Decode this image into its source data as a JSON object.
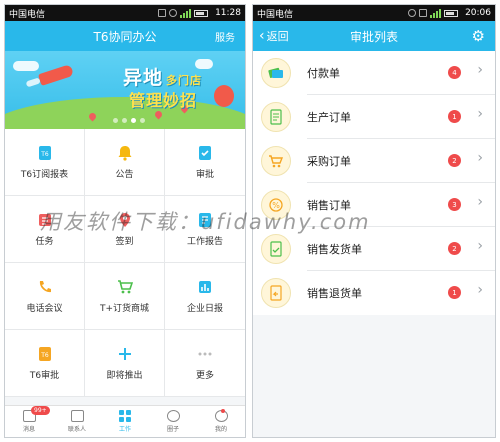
{
  "left": {
    "status": {
      "carrier": "中国电信",
      "time": "11:28"
    },
    "title": "T6协同办公",
    "right_action": "服务",
    "banner": {
      "headline": "异地",
      "headline_small": "多门店",
      "subline": "管理妙招",
      "tag": ""
    },
    "grid": [
      {
        "label": "T6订阅报表",
        "icon": "report-icon",
        "color": "#29b8ea"
      },
      {
        "label": "公告",
        "icon": "bell-icon",
        "color": "#f5b80f"
      },
      {
        "label": "审批",
        "icon": "approve-icon",
        "color": "#29b8ea"
      },
      {
        "label": "任务",
        "icon": "task-icon",
        "color": "#ef5e5e"
      },
      {
        "label": "签到",
        "icon": "checkin-icon",
        "color": "#ef5e5e"
      },
      {
        "label": "工作报告",
        "icon": "work-report-icon",
        "color": "#29b8ea"
      },
      {
        "label": "电话会议",
        "icon": "phone-icon",
        "color": "#f5a623"
      },
      {
        "label": "T+订货商城",
        "icon": "cart-icon",
        "color": "#4cbf4c"
      },
      {
        "label": "企业日报",
        "icon": "daily-report-icon",
        "color": "#29b8ea"
      },
      {
        "label": "T6审批",
        "icon": "t6-approve-icon",
        "color": "#f5a623"
      },
      {
        "label": "即将推出",
        "icon": "plus-icon",
        "color": "#29b8ea"
      },
      {
        "label": "更多",
        "icon": "more-icon",
        "color": "#bbbbbb"
      }
    ],
    "tabs": [
      {
        "label": "消息",
        "badge": "99+"
      },
      {
        "label": "联系人"
      },
      {
        "label": "工作"
      },
      {
        "label": "圈子"
      },
      {
        "label": "我的"
      }
    ]
  },
  "right": {
    "status": {
      "carrier": "中国电信",
      "time": "20:06"
    },
    "back_label": "返回",
    "title": "审批列表",
    "items": [
      {
        "label": "付款单",
        "count": "4",
        "icon": "payment-icon"
      },
      {
        "label": "生产订单",
        "count": "1",
        "icon": "production-order-icon"
      },
      {
        "label": "采购订单",
        "count": "2",
        "icon": "purchase-order-icon"
      },
      {
        "label": "销售订单",
        "count": "3",
        "icon": "sales-order-icon"
      },
      {
        "label": "销售发货单",
        "count": "2",
        "icon": "sales-delivery-icon"
      },
      {
        "label": "销售退货单",
        "count": "1",
        "icon": "sales-return-icon"
      }
    ]
  },
  "watermark": "用友软件下载：ufidawhy.com",
  "colors": {
    "accent": "#29b8ea",
    "badge": "#ef4b4b"
  }
}
